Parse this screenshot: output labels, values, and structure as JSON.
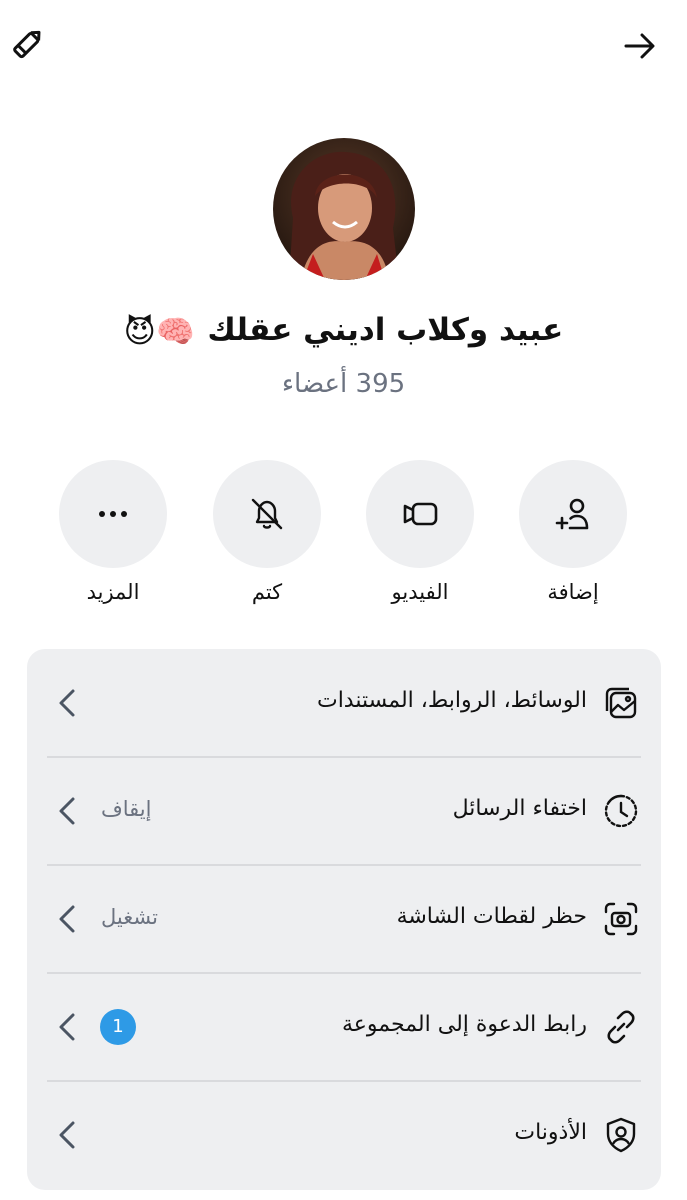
{
  "header": {
    "edit_icon": "pencil-icon",
    "forward_icon": "arrow-right-icon"
  },
  "group": {
    "title": "عبيد وكلاب اديني عقلك",
    "title_emojis": "🧠😈",
    "members_count": "395",
    "members_label": "أعضاء"
  },
  "actions": [
    {
      "label": "إضافة",
      "icon": "add-person-icon"
    },
    {
      "label": "الفيديو",
      "icon": "video-camera-icon"
    },
    {
      "label": "كتم",
      "icon": "bell-off-icon"
    },
    {
      "label": "المزيد",
      "icon": "more-dots-icon"
    }
  ],
  "settings": [
    {
      "label": "الوسائط، الروابط، المستندات",
      "value": "",
      "icon": "media-gallery-icon"
    },
    {
      "label": "اختفاء الرسائل",
      "value": "إيقاف",
      "icon": "timer-icon"
    },
    {
      "label": "حظر لقطات الشاشة",
      "value": "تشغيل",
      "icon": "screenshot-camera-icon"
    },
    {
      "label": "رابط الدعوة إلى المجموعة",
      "value": "",
      "badge": "1",
      "icon": "link-icon"
    },
    {
      "label": "الأذونات",
      "value": "",
      "icon": "shield-person-icon"
    }
  ],
  "colors": {
    "background": "#ffffff",
    "card": "#eeeff1",
    "circle": "#eeeff1",
    "muted_text": "#6b7280",
    "badge": "#2e9ae6"
  }
}
